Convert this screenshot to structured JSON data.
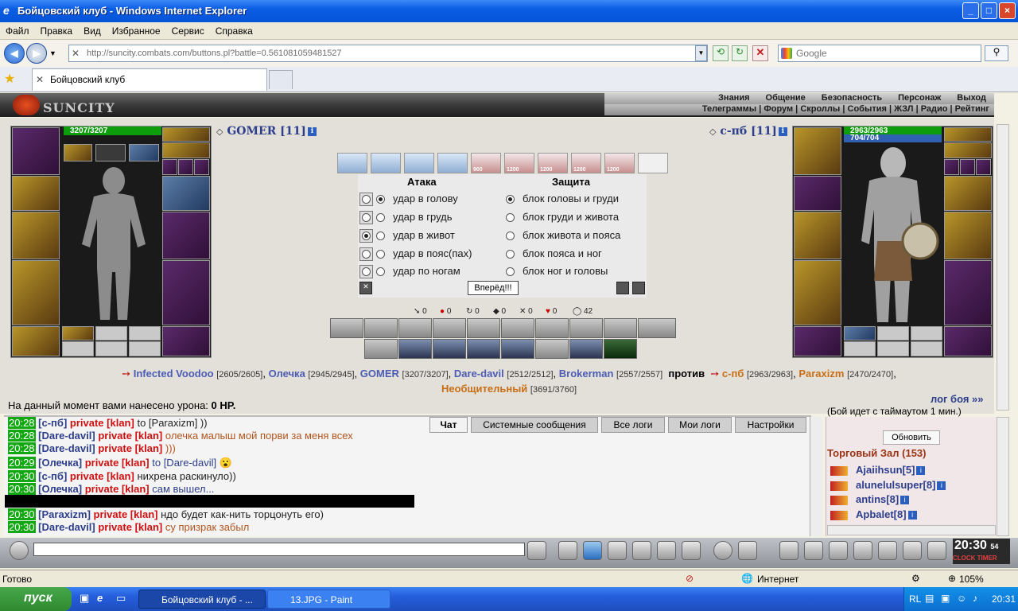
{
  "window": {
    "title": "Бойцовский клуб - Windows Internet Explorer",
    "min": "_",
    "max": "□",
    "close": "×"
  },
  "menu": [
    "Файл",
    "Правка",
    "Вид",
    "Избранное",
    "Сервис",
    "Справка"
  ],
  "address": {
    "url": "http://suncity.combats.com/buttons.pl?battle=0.561081059481527",
    "search_placeholder": "Google"
  },
  "tab": {
    "title": "Бойцовский клуб"
  },
  "game": {
    "logo": "SUNCITY",
    "nav1": [
      "Знания",
      "Общение",
      "Безопасность",
      "Персонаж",
      "Выход"
    ],
    "nav2": "Телеграммы | Форум | Скроллы | События | ЖЗЛ | Радио | Рейтинг",
    "player": {
      "name": "GOMER [11]",
      "hp": "3207/3207"
    },
    "enemy": {
      "name": "с-пб [11]",
      "hp": "2963/2963",
      "mana": "704/704"
    },
    "scroll_labels": [
      "",
      "",
      "",
      "",
      "900",
      "1200",
      "1200",
      "1200",
      "1200",
      ""
    ],
    "attack": {
      "title": "Атака",
      "rows": [
        "удар в голову",
        "удар в грудь",
        "удар в живот",
        "удар в пояс(пах)",
        "удар по ногам"
      ]
    },
    "defense": {
      "title": "Защита",
      "rows": [
        "блок головы и груди",
        "блок груди и живота",
        "блок живота и пояса",
        "блок пояса и ног",
        "блок ног и головы"
      ]
    },
    "go_button": "Вперёд!!!",
    "stats": [
      "0",
      "0",
      "0",
      "0",
      "0",
      "0",
      "42"
    ],
    "battle": {
      "side1": [
        {
          "n": "Infected Voodoo",
          "h": "[2605/2605]"
        },
        {
          "n": "Олечка",
          "h": "[2945/2945]"
        },
        {
          "n": "GOMER",
          "h": "[3207/3207]"
        },
        {
          "n": "Dare-davil",
          "h": "[2512/2512]"
        },
        {
          "n": "Brokerman",
          "h": "[2557/2557]"
        }
      ],
      "vs": "против",
      "side2": [
        {
          "n": "с-пб",
          "h": "[2963/2963]"
        },
        {
          "n": "Paraxizm",
          "h": "[2470/2470]"
        },
        {
          "n": "Необщительный",
          "h": "[3691/3760]"
        }
      ]
    },
    "damage_label": "На данный момент вами нанесено урона:",
    "damage_value": "0 HP.",
    "log_link": "лог боя »»",
    "timeout_text": "(Бой идет с таймаутом 1 мин.)"
  },
  "chat": {
    "tabs": [
      "Чат",
      "Системные сообщения",
      "Все логи",
      "Мои логи",
      "Настройки"
    ],
    "lines": [
      {
        "time": "20:28",
        "nick": "[с-пб]",
        "priv": "private [klan]",
        "msg": "to [Paraxizm] ))",
        "c": "k"
      },
      {
        "time": "20:28",
        "nick": "[Dare-davil]",
        "priv": "private [klan]",
        "msg": "олечка малыш мой порви за меня всех",
        "c": "o"
      },
      {
        "time": "20:28",
        "nick": "[Dare-davil]",
        "priv": "private [klan]",
        "msg": ")))",
        "c": "o"
      },
      {
        "time": "20:29",
        "nick": "[Олечка]",
        "priv": "private [klan]",
        "msg": "to [Dare-davil] 😮",
        "c": "b"
      },
      {
        "time": "20:30",
        "nick": "[с-пб]",
        "priv": "private [klan]",
        "msg": "нихрена раскинуло))",
        "c": "k"
      },
      {
        "time": "20:30",
        "nick": "[Олечка]",
        "priv": "private [klan]",
        "msg": "сам вышел...",
        "c": "b"
      },
      {
        "time": "",
        "nick": "",
        "priv": "",
        "msg": "",
        "c": "k"
      },
      {
        "time": "20:30",
        "nick": "[Paraxizm]",
        "priv": "private [klan]",
        "msg": "ндо будет как-нить торцонуть его)",
        "c": "k"
      },
      {
        "time": "20:30",
        "nick": "[Dare-davil]",
        "priv": "private [klan]",
        "msg": "су призрак забыл",
        "c": "o"
      }
    ]
  },
  "sidebar": {
    "refresh": "Обновить",
    "hall_title": "Торговый Зал (153)",
    "users": [
      "Ajaiihsun[5]",
      "alunelulsuper[8]",
      "antins[8]",
      "Apbalet[8]"
    ]
  },
  "clock": {
    "time": "20:30",
    "sec": "54",
    "label": "CLOCK TIMER"
  },
  "status": {
    "left": "Готово",
    "zone": "Интернет",
    "zoom": "105%"
  },
  "taskbar": {
    "start": "пуск",
    "tasks": [
      "Бойцовский клуб - ...",
      "13.JPG - Paint"
    ],
    "lang": "RL",
    "time": "20:31"
  }
}
